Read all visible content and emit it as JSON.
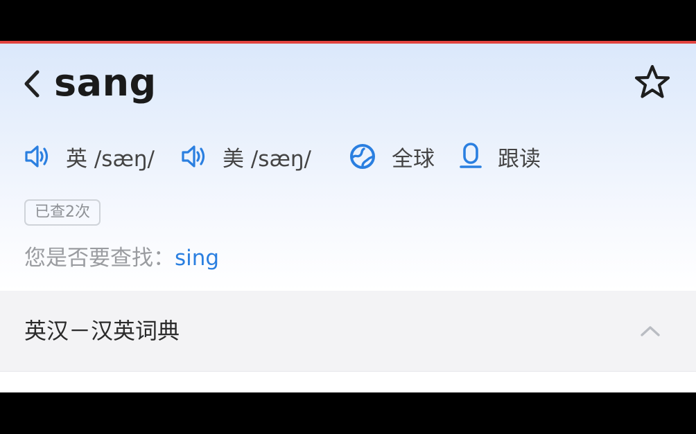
{
  "header": {
    "word": "sang",
    "back_icon": "chevron-left-icon",
    "favorite_icon": "star-outline-icon"
  },
  "pronunciations": [
    {
      "region": "英",
      "phonetic": "/sæŋ/",
      "icon": "speaker-icon"
    },
    {
      "region": "美",
      "phonetic": "/sæŋ/",
      "icon": "speaker-icon"
    }
  ],
  "actions": {
    "global": {
      "label": "全球",
      "icon": "globe-icon"
    },
    "follow_read": {
      "label": "跟读",
      "icon": "microphone-icon"
    }
  },
  "lookup_badge": "已查2次",
  "suggestion": {
    "prompt": "您是否要查找：",
    "word": "sing"
  },
  "section": {
    "title": "英汉－汉英词典",
    "expand_icon": "chevron-up-icon"
  },
  "colors": {
    "accent": "#2a7fe0",
    "top_bar_line": "#e2433f",
    "header_gradient_top": "#dbe8fb",
    "section_bg": "#f3f3f5"
  }
}
